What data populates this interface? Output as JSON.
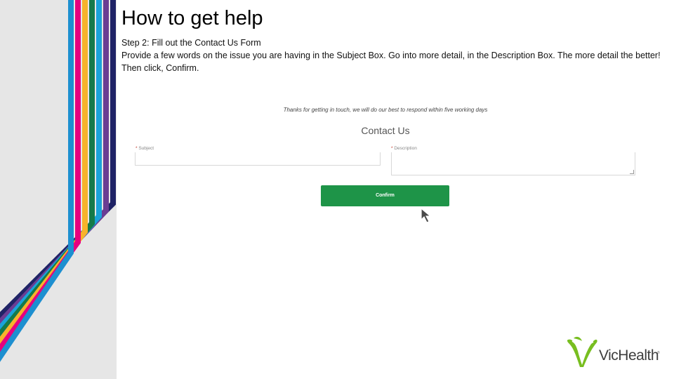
{
  "slide": {
    "title": "How to get help",
    "step_heading": "Step 2: Fill out the Contact Us Form",
    "step_body": "Provide a few words on the issue you are having in the Subject Box. Go into more detail, in the Description Box. The more detail the better! Then click, Confirm."
  },
  "form": {
    "intro": "Thanks for getting in touch, we will do our best to respond within five working days",
    "title": "Contact Us",
    "required_marker": "*",
    "subject_label": "Subject",
    "description_label": "Description",
    "confirm_label": "Confirm"
  },
  "logo": {
    "text": "VicHealth",
    "registered_mark": "®"
  },
  "colors": {
    "stripes": [
      "#1f2366",
      "#6a3d93",
      "#1aa3d9",
      "#e6007e",
      "#f7b32b",
      "#157a4a",
      "#1d8fd0"
    ],
    "button": "#1e9448",
    "logo_green": "#78be20"
  }
}
